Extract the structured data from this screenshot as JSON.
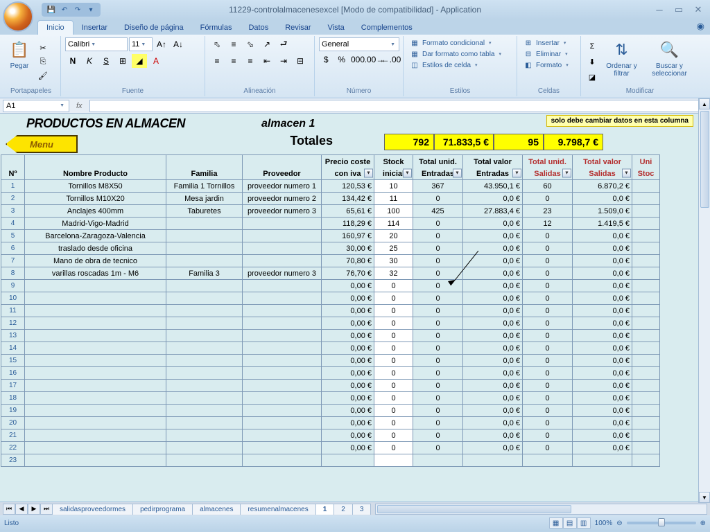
{
  "titlebar": {
    "title": "11229-controlalmacenesexcel  [Modo de compatibilidad] - Application"
  },
  "tabs": {
    "inicio": "Inicio",
    "insertar": "Insertar",
    "diseno": "Diseño de página",
    "formulas": "Fórmulas",
    "datos": "Datos",
    "revisar": "Revisar",
    "vista": "Vista",
    "complementos": "Complementos"
  },
  "ribbon": {
    "portapapeles": {
      "label": "Portapapeles",
      "pegar": "Pegar"
    },
    "fuente": {
      "label": "Fuente",
      "font": "Calibri",
      "size": "11",
      "bold": "N",
      "italic": "K",
      "underline": "S"
    },
    "alineacion": {
      "label": "Alineación"
    },
    "numero": {
      "label": "Número",
      "format": "General"
    },
    "estilos": {
      "label": "Estilos",
      "condicional": "Formato condicional",
      "tabla": "Dar formato como tabla",
      "celda": "Estilos de celda"
    },
    "celdas": {
      "label": "Celdas",
      "insertar": "Insertar",
      "eliminar": "Eliminar",
      "formato": "Formato"
    },
    "modificar": {
      "label": "Modificar",
      "ordenar": "Ordenar y filtrar",
      "buscar": "Buscar y seleccionar"
    }
  },
  "formula_bar": {
    "cell_ref": "A1",
    "fx": "fx"
  },
  "sheet": {
    "title": "PRODUCTOS EN ALMACEN",
    "subtitle": "almacen 1",
    "note": "solo debe cambiar datos en esta columna",
    "menu_btn": "Menu",
    "totals_label": "Totales",
    "totals": {
      "stock": "792",
      "valor_ent": "71.833,5 €",
      "unid_sal": "95",
      "valor_sal": "9.798,7 €"
    }
  },
  "headers": {
    "no": "Nº",
    "nombre": "Nombre Producto",
    "familia": "Familia",
    "proveedor": "Proveedor",
    "precio1": "Precio coste",
    "precio2": "con iva",
    "stock1": "Stock",
    "stock2": "inicial",
    "tent1": "Total unid.",
    "tent2": "Entradas",
    "vent1": "Total valor",
    "vent2": "Entradas",
    "tsal1": "Total unid.",
    "tsal2": "Salidas",
    "vsal1": "Total valor",
    "vsal2": "Salidas",
    "uni": "Uni",
    "stoc": "Stoc"
  },
  "rows": [
    {
      "n": "1",
      "nombre": "Tornillos M8X50",
      "familia": "Familia 1 Tornillos",
      "prov": "proveedor numero 1",
      "precio": "120,53 €",
      "stock": "10",
      "uent": "367",
      "vent": "43.950,1 €",
      "usal": "60",
      "vsal": "6.870,2 €"
    },
    {
      "n": "2",
      "nombre": "Tornillos M10X20",
      "familia": "Mesa jardin",
      "prov": "proveedor numero 2",
      "precio": "134,42 €",
      "stock": "11",
      "uent": "0",
      "vent": "0,0 €",
      "usal": "0",
      "vsal": "0,0 €"
    },
    {
      "n": "3",
      "nombre": "Anclajes 400mm",
      "familia": "Taburetes",
      "prov": "proveedor numero 3",
      "precio": "65,61 €",
      "stock": "100",
      "uent": "425",
      "vent": "27.883,4 €",
      "usal": "23",
      "vsal": "1.509,0 €"
    },
    {
      "n": "4",
      "nombre": "Madrid-Vigo-Madrid",
      "familia": "",
      "prov": "",
      "precio": "118,29 €",
      "stock": "114",
      "uent": "0",
      "vent": "0,0 €",
      "usal": "12",
      "vsal": "1.419,5 €"
    },
    {
      "n": "5",
      "nombre": "Barcelona-Zaragoza-Valencia",
      "familia": "",
      "prov": "",
      "precio": "160,97 €",
      "stock": "20",
      "uent": "0",
      "vent": "0,0 €",
      "usal": "0",
      "vsal": "0,0 €"
    },
    {
      "n": "6",
      "nombre": "traslado desde oficina",
      "familia": "",
      "prov": "",
      "precio": "30,00 €",
      "stock": "25",
      "uent": "0",
      "vent": "0,0 €",
      "usal": "0",
      "vsal": "0,0 €"
    },
    {
      "n": "7",
      "nombre": "Mano de obra de tecnico",
      "familia": "",
      "prov": "",
      "precio": "70,80 €",
      "stock": "30",
      "uent": "0",
      "vent": "0,0 €",
      "usal": "0",
      "vsal": "0,0 €"
    },
    {
      "n": "8",
      "nombre": "varillas roscadas 1m - M6",
      "familia": "Familia 3",
      "prov": "proveedor numero 3",
      "precio": "76,70 €",
      "stock": "32",
      "uent": "0",
      "vent": "0,0 €",
      "usal": "0",
      "vsal": "0,0 €"
    },
    {
      "n": "9",
      "nombre": "",
      "familia": "",
      "prov": "",
      "precio": "0,00 €",
      "stock": "0",
      "uent": "0",
      "vent": "0,0 €",
      "usal": "0",
      "vsal": "0,0 €"
    },
    {
      "n": "10",
      "nombre": "",
      "familia": "",
      "prov": "",
      "precio": "0,00 €",
      "stock": "0",
      "uent": "0",
      "vent": "0,0 €",
      "usal": "0",
      "vsal": "0,0 €"
    },
    {
      "n": "11",
      "nombre": "",
      "familia": "",
      "prov": "",
      "precio": "0,00 €",
      "stock": "0",
      "uent": "0",
      "vent": "0,0 €",
      "usal": "0",
      "vsal": "0,0 €"
    },
    {
      "n": "12",
      "nombre": "",
      "familia": "",
      "prov": "",
      "precio": "0,00 €",
      "stock": "0",
      "uent": "0",
      "vent": "0,0 €",
      "usal": "0",
      "vsal": "0,0 €"
    },
    {
      "n": "13",
      "nombre": "",
      "familia": "",
      "prov": "",
      "precio": "0,00 €",
      "stock": "0",
      "uent": "0",
      "vent": "0,0 €",
      "usal": "0",
      "vsal": "0,0 €"
    },
    {
      "n": "14",
      "nombre": "",
      "familia": "",
      "prov": "",
      "precio": "0,00 €",
      "stock": "0",
      "uent": "0",
      "vent": "0,0 €",
      "usal": "0",
      "vsal": "0,0 €"
    },
    {
      "n": "15",
      "nombre": "",
      "familia": "",
      "prov": "",
      "precio": "0,00 €",
      "stock": "0",
      "uent": "0",
      "vent": "0,0 €",
      "usal": "0",
      "vsal": "0,0 €"
    },
    {
      "n": "16",
      "nombre": "",
      "familia": "",
      "prov": "",
      "precio": "0,00 €",
      "stock": "0",
      "uent": "0",
      "vent": "0,0 €",
      "usal": "0",
      "vsal": "0,0 €"
    },
    {
      "n": "17",
      "nombre": "",
      "familia": "",
      "prov": "",
      "precio": "0,00 €",
      "stock": "0",
      "uent": "0",
      "vent": "0,0 €",
      "usal": "0",
      "vsal": "0,0 €"
    },
    {
      "n": "18",
      "nombre": "",
      "familia": "",
      "prov": "",
      "precio": "0,00 €",
      "stock": "0",
      "uent": "0",
      "vent": "0,0 €",
      "usal": "0",
      "vsal": "0,0 €"
    },
    {
      "n": "19",
      "nombre": "",
      "familia": "",
      "prov": "",
      "precio": "0,00 €",
      "stock": "0",
      "uent": "0",
      "vent": "0,0 €",
      "usal": "0",
      "vsal": "0,0 €"
    },
    {
      "n": "20",
      "nombre": "",
      "familia": "",
      "prov": "",
      "precio": "0,00 €",
      "stock": "0",
      "uent": "0",
      "vent": "0,0 €",
      "usal": "0",
      "vsal": "0,0 €"
    },
    {
      "n": "21",
      "nombre": "",
      "familia": "",
      "prov": "",
      "precio": "0,00 €",
      "stock": "0",
      "uent": "0",
      "vent": "0,0 €",
      "usal": "0",
      "vsal": "0,0 €"
    },
    {
      "n": "22",
      "nombre": "",
      "familia": "",
      "prov": "",
      "precio": "0,00 €",
      "stock": "0",
      "uent": "0",
      "vent": "0,0 €",
      "usal": "0",
      "vsal": "0,0 €"
    },
    {
      "n": "23",
      "nombre": "",
      "familia": "",
      "prov": "",
      "precio": "",
      "stock": "",
      "uent": "",
      "vent": "",
      "usal": "",
      "vsal": ""
    }
  ],
  "sheet_tabs": {
    "t1": "salidasproveedormes",
    "t2": "pedirprograma",
    "t3": "almacenes",
    "t4": "resumenalmacenes",
    "t5": "1",
    "t6": "2",
    "t7": "3"
  },
  "status": {
    "ready": "Listo",
    "zoom": "100%"
  }
}
